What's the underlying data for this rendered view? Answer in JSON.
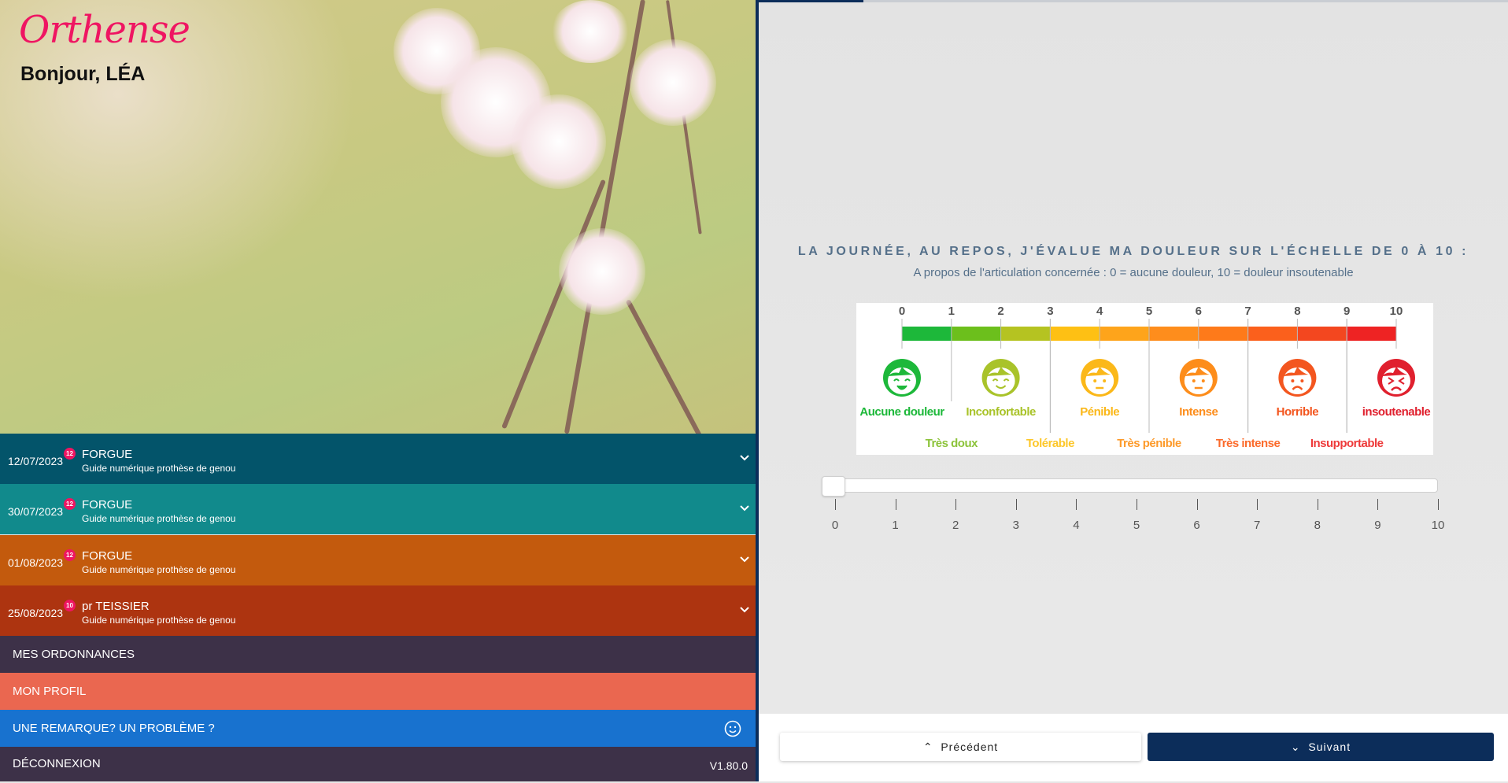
{
  "header": {
    "logo": "Orthense",
    "greeting": "Bonjour, LÉA"
  },
  "appointments": [
    {
      "date": "12/07/2023",
      "badge": "12",
      "name": "FORGUE",
      "subtitle": "Guide numérique prothèse de genou",
      "color": "#03546a"
    },
    {
      "date": "30/07/2023",
      "badge": "12",
      "name": "FORGUE",
      "subtitle": "Guide numérique prothèse de genou",
      "color": "#118a8c"
    },
    {
      "date": "01/08/2023",
      "badge": "12",
      "name": "FORGUE",
      "subtitle": "Guide numérique prothèse de genou",
      "color": "#c35a0d"
    },
    {
      "date": "25/08/2023",
      "badge": "10",
      "name": "pr TEISSIER",
      "subtitle": "Guide numérique prothèse de genou",
      "color": "#ad3410"
    }
  ],
  "nav": {
    "ordonnances": "MES ORDONNANCES",
    "profil": "MON PROFIL",
    "remarque": "UNE REMARQUE? UN PROBLÈME ?",
    "deconnexion": "DÉCONNEXION",
    "version": "V1.80.0"
  },
  "question": {
    "title": "LA JOURNÉE, AU REPOS, J'ÉVALUE MA DOULEUR SUR L'ÉCHELLE DE 0 À 10 :",
    "subtitle": "A propos de l'articulation concernée : 0 = aucune douleur, 10 = douleur insoutenable",
    "progress_percent": 14
  },
  "pain_scale": {
    "numbers": [
      "0",
      "1",
      "2",
      "3",
      "4",
      "5",
      "6",
      "7",
      "8",
      "9",
      "10"
    ],
    "colors": [
      "#1db83a",
      "#6cbf1c",
      "#b5c321",
      "#fec014",
      "#fea41b",
      "#fe8d1c",
      "#fe7a1a",
      "#fb601c",
      "#f3471f",
      "#ee2323"
    ],
    "faces": [
      {
        "label": "Aucune douleur",
        "at": 0,
        "color": "#1db83a"
      },
      {
        "label": "Inconfortable",
        "at": 2,
        "color": "#a9c32a"
      },
      {
        "label": "Pénible",
        "at": 4,
        "color": "#fbb819"
      },
      {
        "label": "Intense",
        "at": 6,
        "color": "#fd8d1b"
      },
      {
        "label": "Horrible",
        "at": 8,
        "color": "#f3561f"
      },
      {
        "label": "insoutenable",
        "at": 10,
        "color": "#e0202e"
      }
    ],
    "between": [
      {
        "label": "Très doux",
        "at": 1,
        "color": "#8cc33a"
      },
      {
        "label": "Tolérable",
        "at": 3,
        "color": "#fdc72a"
      },
      {
        "label": "Très pénible",
        "at": 5,
        "color": "#fd9a2a"
      },
      {
        "label": "Très intense",
        "at": 7,
        "color": "#fb6a2a"
      },
      {
        "label": "Insupportable",
        "at": 9,
        "color": "#ee3a3a"
      }
    ]
  },
  "slider": {
    "value": 0,
    "min": 0,
    "max": 10,
    "labels": [
      "0",
      "1",
      "2",
      "3",
      "4",
      "5",
      "6",
      "7",
      "8",
      "9",
      "10"
    ]
  },
  "footer": {
    "previous": "Précédent",
    "next": "Suivant"
  }
}
